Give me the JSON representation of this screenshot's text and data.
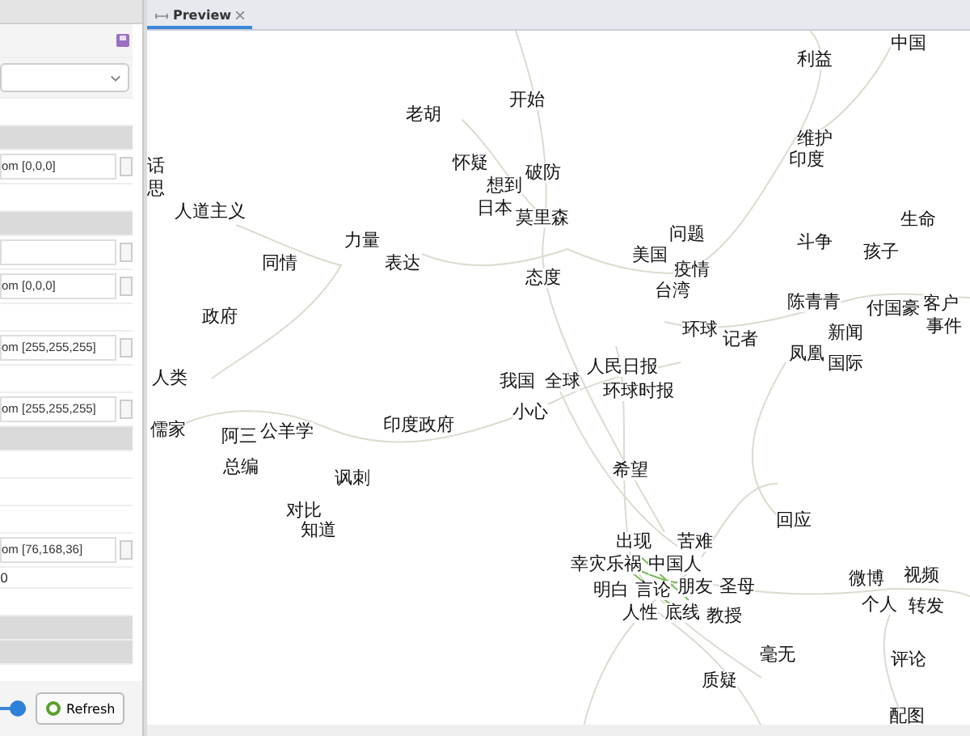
{
  "settings_panel": {
    "rows": [
      {
        "kind": "icon"
      },
      {
        "kind": "dropdown"
      },
      {
        "kind": "blank"
      },
      {
        "kind": "section"
      },
      {
        "kind": "color",
        "value": "om [0,0,0]"
      },
      {
        "kind": "blank"
      },
      {
        "kind": "section"
      },
      {
        "kind": "color",
        "value": ""
      },
      {
        "kind": "color",
        "value": "om [0,0,0]"
      },
      {
        "kind": "blank"
      },
      {
        "kind": "color",
        "value": "om [255,255,255]"
      },
      {
        "kind": "blank"
      },
      {
        "kind": "color",
        "value": "om [255,255,255]"
      },
      {
        "kind": "section"
      },
      {
        "kind": "blank"
      },
      {
        "kind": "blank"
      },
      {
        "kind": "blank"
      },
      {
        "kind": "color",
        "value": "om [76,168,36]"
      },
      {
        "kind": "text",
        "value": "0"
      },
      {
        "kind": "blank"
      },
      {
        "kind": "section"
      },
      {
        "kind": "section"
      }
    ],
    "slider": {
      "level": 1
    },
    "refresh_button": "Refresh"
  },
  "preview": {
    "tab": {
      "label": "Preview",
      "selected": true
    },
    "nodes": [
      {
        "label": "中国"
      },
      {
        "label": "利益"
      },
      {
        "label": "开始"
      },
      {
        "label": "老胡"
      },
      {
        "label": "维护"
      },
      {
        "label": "话"
      },
      {
        "label": "怀疑"
      },
      {
        "label": "破防"
      },
      {
        "label": "印度"
      },
      {
        "label": "思"
      },
      {
        "label": "想到"
      },
      {
        "label": "日本"
      },
      {
        "label": "人道主义"
      },
      {
        "label": "莫里森"
      },
      {
        "label": "生命"
      },
      {
        "label": "力量"
      },
      {
        "label": "问题"
      },
      {
        "label": "美国"
      },
      {
        "label": "斗争"
      },
      {
        "label": "孩子"
      },
      {
        "label": "同情"
      },
      {
        "label": "表达"
      },
      {
        "label": "疫情"
      },
      {
        "label": "态度"
      },
      {
        "label": "台湾"
      },
      {
        "label": "陈青青"
      },
      {
        "label": "付国豪"
      },
      {
        "label": "客户"
      },
      {
        "label": "政府"
      },
      {
        "label": "环球"
      },
      {
        "label": "记者"
      },
      {
        "label": "新闻"
      },
      {
        "label": "事件"
      },
      {
        "label": "人类"
      },
      {
        "label": "我国"
      },
      {
        "label": "全球"
      },
      {
        "label": "人民日报"
      },
      {
        "label": "凤凰"
      },
      {
        "label": "国际"
      },
      {
        "label": "环球时报"
      },
      {
        "label": "儒家"
      },
      {
        "label": "阿三"
      },
      {
        "label": "公羊学"
      },
      {
        "label": "印度政府"
      },
      {
        "label": "小心"
      },
      {
        "label": "总编"
      },
      {
        "label": "讽刺"
      },
      {
        "label": "希望"
      },
      {
        "label": "对比"
      },
      {
        "label": "知道"
      },
      {
        "label": "回应"
      },
      {
        "label": "出现"
      },
      {
        "label": "苦难"
      },
      {
        "label": "幸灾乐祸"
      },
      {
        "label": "中国人"
      },
      {
        "label": "明白"
      },
      {
        "label": "言论"
      },
      {
        "label": "朋友"
      },
      {
        "label": "圣母"
      },
      {
        "label": "微博"
      },
      {
        "label": "视频"
      },
      {
        "label": "人性"
      },
      {
        "label": "底线"
      },
      {
        "label": "教授"
      },
      {
        "label": "个人"
      },
      {
        "label": "转发"
      },
      {
        "label": "毫无"
      },
      {
        "label": "评论"
      },
      {
        "label": "质疑"
      },
      {
        "label": "配图"
      }
    ]
  }
}
